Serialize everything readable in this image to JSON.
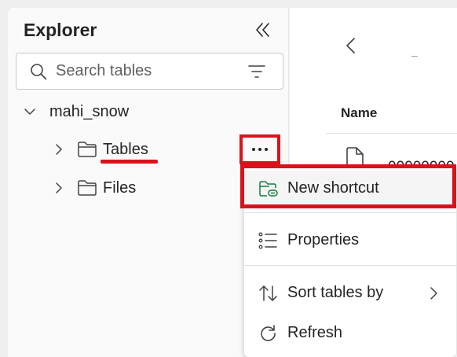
{
  "explorer": {
    "title": "Explorer",
    "search_placeholder": "Search tables",
    "lakehouse_name": "mahi_snow",
    "tree": [
      {
        "label": "Tables"
      },
      {
        "label": "Files"
      }
    ]
  },
  "right_pane": {
    "column_header": "Name",
    "file_name": "00000000"
  },
  "context_menu": {
    "items": [
      {
        "label": "New shortcut",
        "icon": "folder-shortcut-icon"
      },
      {
        "label": "Properties",
        "icon": "properties-icon"
      },
      {
        "label": "Sort tables by",
        "icon": "sort-icon"
      },
      {
        "label": "Refresh",
        "icon": "refresh-icon"
      }
    ]
  },
  "colors": {
    "annotation_red": "#d9131c",
    "shortcut_icon_green": "#107c41"
  }
}
